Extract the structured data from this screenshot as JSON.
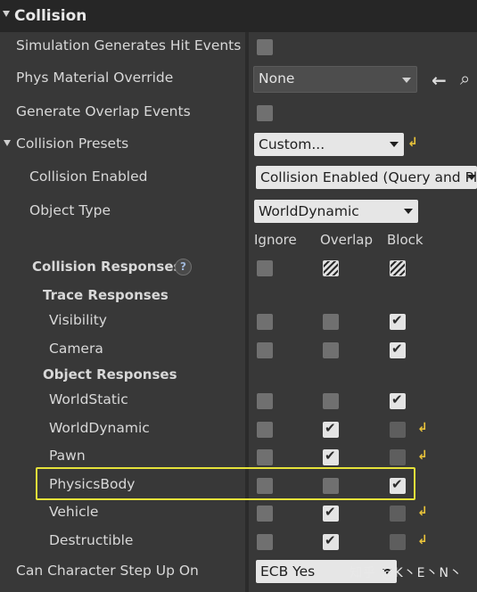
{
  "section": {
    "title": "Collision"
  },
  "rows": {
    "sim_hit": "Simulation Generates Hit Events",
    "phys_mat": "Phys Material Override",
    "phys_mat_value": "None",
    "overlap_events": "Generate Overlap Events",
    "presets": "Collision Presets",
    "presets_value": "Custom...",
    "collision_enabled": "Collision Enabled",
    "collision_enabled_value": "Collision Enabled (Query and Pl",
    "object_type": "Object Type",
    "object_type_value": "WorldDynamic",
    "collision_responses": "Collision Responses",
    "trace_responses": "Trace Responses",
    "object_responses": "Object Responses",
    "step_up": "Can Character Step Up On",
    "step_up_value": "ECB Yes"
  },
  "columns": {
    "ignore": "Ignore",
    "overlap": "Overlap",
    "block": "Block"
  },
  "trace_channels": [
    "Visibility",
    "Camera"
  ],
  "object_channels": [
    "WorldStatic",
    "WorldDynamic",
    "Pawn",
    "PhysicsBody",
    "Vehicle",
    "Destructible"
  ],
  "response_states": {
    "Visibility": "block",
    "Camera": "block",
    "WorldStatic": "block",
    "WorldDynamic": "overlap",
    "Pawn": "overlap",
    "PhysicsBody": "block",
    "Vehicle": "overlap",
    "Destructible": "overlap"
  },
  "highlighted_channel": "PhysicsBody",
  "watermark": "知乎 @K丶E丶N丶",
  "colors": {
    "highlight": "#e6e23a",
    "reset_arrow": "#e8c23a"
  },
  "icons": [
    "collapse-triangle-icon",
    "back-arrow-icon",
    "search-icon",
    "help-icon",
    "reset-to-default-icon",
    "checkmark-icon"
  ]
}
